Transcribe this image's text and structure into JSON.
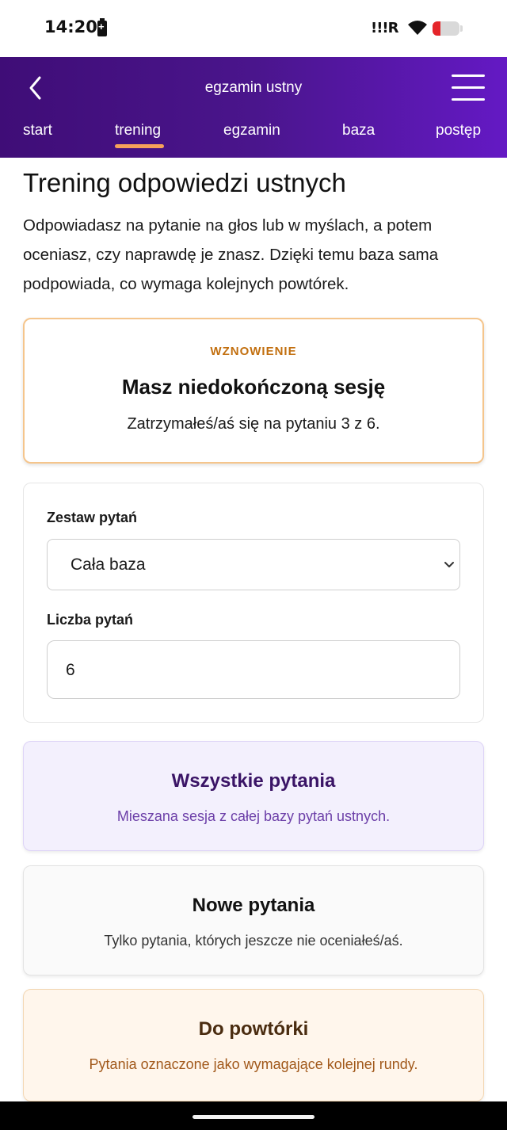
{
  "status_bar": {
    "time": "14:20",
    "signal_text": "!!!R",
    "battery_level": 0.3,
    "icons": [
      "battery-charging-icon",
      "signal-icon",
      "wifi-icon",
      "battery-icon"
    ]
  },
  "header": {
    "title": "egzamin ustny",
    "back_icon": "chevron-left-icon",
    "menu_icon": "hamburger-menu-icon",
    "gradient_colors": [
      "#3f0d77",
      "#6419c4"
    ]
  },
  "tabs": [
    {
      "label": "start",
      "active": false
    },
    {
      "label": "trening",
      "active": true
    },
    {
      "label": "egzamin",
      "active": false
    },
    {
      "label": "baza",
      "active": false
    },
    {
      "label": "postęp",
      "active": false
    }
  ],
  "colors": {
    "accent_orange": "#f7a25a",
    "resume_border": "#f5c58c",
    "purple_dark": "#3a1466"
  },
  "page": {
    "title": "Trening odpowiedzi ustnych",
    "intro": "Odpowiadasz na pytanie na głos lub w myślach, a potem oceniasz, czy naprawdę je znasz. Dzięki temu baza sama podpowiada, co wymaga kolejnych powtórek."
  },
  "resume": {
    "kicker": "WZNOWIENIE",
    "title": "Masz niedokończoną sesję",
    "description": "Zatrzymałeś/aś się na pytaniu 3 z 6."
  },
  "settings": {
    "set_label": "Zestaw pytań",
    "set_value": "Cała baza",
    "count_label": "Liczba pytań",
    "count_value": "6"
  },
  "modes": [
    {
      "title": "Wszystkie pytania",
      "description": "Mieszana sesja z całej bazy pytań ustnych."
    },
    {
      "title": "Nowe pytania",
      "description": "Tylko pytania, których jeszcze nie oceniałeś/aś."
    },
    {
      "title": "Do powtórki",
      "description": "Pytania oznaczone jako wymagające kolejnej rundy."
    }
  ]
}
